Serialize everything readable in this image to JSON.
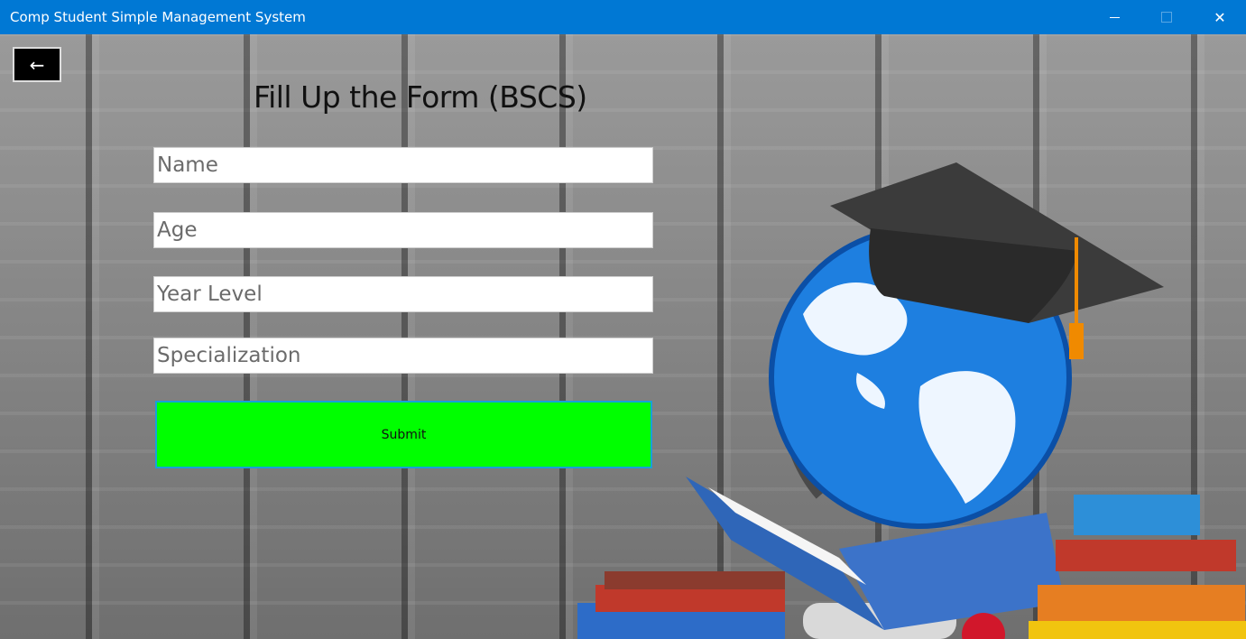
{
  "window": {
    "title": "Comp Student Simple Management System",
    "minimize_icon": "minimize-icon",
    "maximize_icon": "maximize-icon",
    "close_icon": "close-icon",
    "close_glyph": "✕"
  },
  "nav": {
    "back_glyph": "←",
    "back_icon": "arrow-left-icon"
  },
  "form": {
    "title": "Fill Up the Form (BSCS)",
    "fields": [
      {
        "placeholder": "Name",
        "value": ""
      },
      {
        "placeholder": "Age",
        "value": ""
      },
      {
        "placeholder": "Year Level",
        "value": ""
      },
      {
        "placeholder": "Specialization",
        "value": ""
      }
    ],
    "submit_label": "Submit"
  },
  "colors": {
    "titlebar": "#0078d4",
    "submit_bg": "#00ff00",
    "submit_border": "#1a9fd8"
  },
  "decoration": {
    "image": "graduation-globe-books-illustration"
  }
}
